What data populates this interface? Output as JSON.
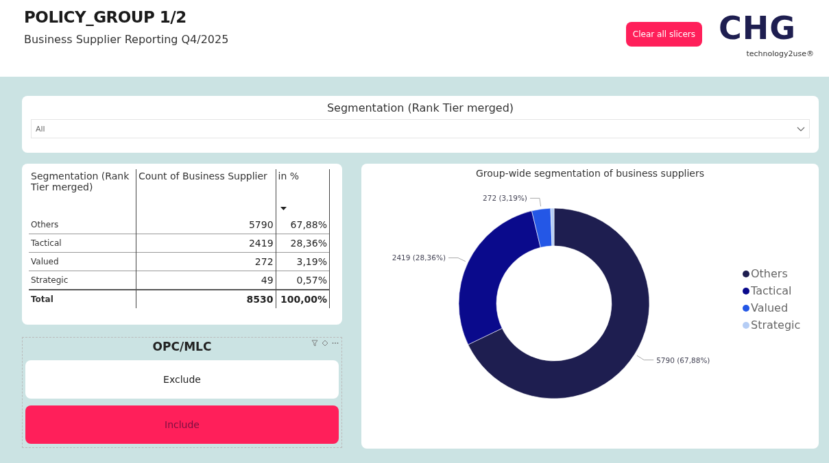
{
  "header": {
    "title": "POLICY_GROUP 1/2",
    "subtitle": "Business Supplier Reporting Q4/2025",
    "clear_button": "Clear all slicers",
    "logo": {
      "wordmark": "CHG",
      "tagline": "technology2use®"
    }
  },
  "segmentation_slicer": {
    "title": "Segmentation (Rank Tier merged)",
    "value": "All"
  },
  "table": {
    "columns": [
      {
        "label": "Segmentation (Rank Tier merged)",
        "sorted": false
      },
      {
        "label": "Count of Business Supplier",
        "sorted": false
      },
      {
        "label": "in %",
        "sorted": true
      }
    ],
    "rows": [
      [
        "Others",
        "5790",
        "67,88%"
      ],
      [
        "Tactical",
        "2419",
        "28,36%"
      ],
      [
        "Valued",
        "272",
        "3,19%"
      ],
      [
        "Strategic",
        "49",
        "0,57%"
      ]
    ],
    "total": [
      "Total",
      "8530",
      "100,00%"
    ]
  },
  "opc_slicer": {
    "title": "OPC/MLC",
    "options": [
      {
        "label": "Exclude",
        "selected": false
      },
      {
        "label": "Include",
        "selected": true
      }
    ]
  },
  "chart": {
    "title": "Group-wide segmentation of business suppliers",
    "chart_data": {
      "type": "donut",
      "categories": [
        "Others",
        "Tactical",
        "Valued",
        "Strategic"
      ],
      "colors": [
        "#1e1e50",
        "#0a0a8c",
        "#2457e6",
        "#b5cdf5"
      ],
      "values": [
        67.88,
        28.36,
        3.19,
        0.57
      ],
      "legend": "right",
      "value_labels": [
        "5790 (67,88%)",
        "2419 (28,36%)",
        "272 (3,19%)",
        null
      ]
    }
  }
}
